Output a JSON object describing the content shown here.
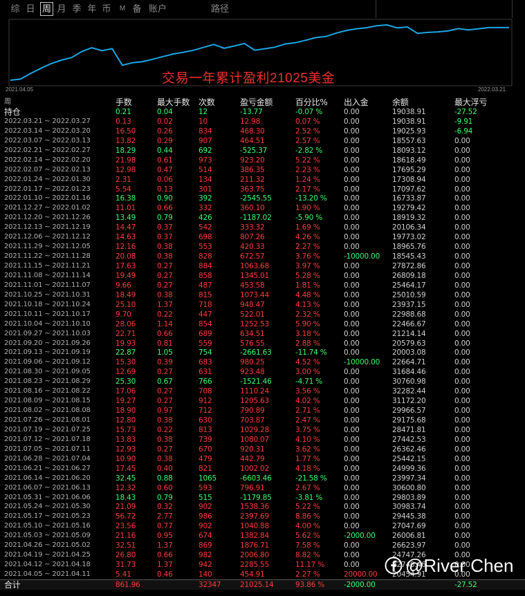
{
  "tabs": [
    {
      "label": "综"
    },
    {
      "label": "日"
    },
    {
      "label": "周",
      "active": true
    },
    {
      "label": "月"
    },
    {
      "label": "季"
    },
    {
      "label": "年"
    },
    {
      "label": "币"
    },
    {
      "label": "M"
    },
    {
      "label": "备"
    },
    {
      "label": "账户"
    },
    {
      "label": "路径"
    }
  ],
  "chart": {
    "start_label": "2021.04.05",
    "end_label": "2022.03.21",
    "caption": "交易一年累计盈利21025美金",
    "line_color": "#1aa7e6",
    "caption_color": "#e8322a"
  },
  "headers": [
    "周",
    "手数",
    "最大手数",
    "次数",
    "盈亏金额",
    "百分比%",
    "出入金",
    "余额",
    "最大浮亏"
  ],
  "hold_row": {
    "label": "持仓",
    "cols": [
      "0.21",
      "0.04",
      "12",
      "-13.77",
      "-0.07 %",
      "0.00",
      "19038.91",
      "-27.52"
    ],
    "sign": "neg"
  },
  "rows": [
    {
      "label": "2022.03.21 ~ 2022.03.27",
      "cols": [
        "0.13",
        "0.02",
        "10",
        "12.98",
        "0.07 %",
        "0.00",
        "19038.91",
        "-9.91"
      ],
      "sign": "pos",
      "dd": "neg"
    },
    {
      "label": "2022.03.14 ~ 2022.03.20",
      "cols": [
        "16.50",
        "0.26",
        "834",
        "468.30",
        "2.52 %",
        "0.00",
        "19025.93",
        "-6.94"
      ],
      "sign": "pos",
      "dd": "neg"
    },
    {
      "label": "2022.03.07 ~ 2022.03.13",
      "cols": [
        "13.82",
        "0.29",
        "907",
        "464.51",
        "2.57 %",
        "0.00",
        "18557.63",
        "0.00"
      ],
      "sign": "pos"
    },
    {
      "label": "2022.02.21 ~ 2022.02.27",
      "cols": [
        "18.29",
        "0.44",
        "692",
        "-525.37",
        "-2.82 %",
        "0.00",
        "18093.12",
        "0.00"
      ],
      "sign": "neg"
    },
    {
      "label": "2022.02.14 ~ 2022.02.20",
      "cols": [
        "21.98",
        "0.61",
        "973",
        "923.20",
        "5.22 %",
        "0.00",
        "18618.49",
        "0.00"
      ],
      "sign": "pos"
    },
    {
      "label": "2022.02.07 ~ 2022.02.13",
      "cols": [
        "12.98",
        "0.47",
        "514",
        "386.35",
        "2.23 %",
        "0.00",
        "17695.29",
        "0.00"
      ],
      "sign": "pos"
    },
    {
      "label": "2022.01.24 ~ 2022.01.30",
      "cols": [
        "2.31",
        "0.06",
        "134",
        "211.32",
        "1.24 %",
        "0.00",
        "17308.94",
        "0.00"
      ],
      "sign": "pos"
    },
    {
      "label": "2022.01.17 ~ 2022.01.23",
      "cols": [
        "5.54",
        "0.13",
        "301",
        "363.75",
        "2.17 %",
        "0.00",
        "17097.62",
        "0.00"
      ],
      "sign": "pos"
    },
    {
      "label": "2022.01.10 ~ 2022.01.16",
      "cols": [
        "16.38",
        "0.90",
        "392",
        "-2545.55",
        "-13.20 %",
        "0.00",
        "16733.87",
        "0.00"
      ],
      "sign": "neg"
    },
    {
      "label": "2021.12.27 ~ 2022.01.02",
      "cols": [
        "11.01",
        "0.66",
        "332",
        "360.10",
        "1.90 %",
        "0.00",
        "19279.42",
        "0.00"
      ],
      "sign": "pos"
    },
    {
      "label": "2021.12.20 ~ 2021.12.26",
      "cols": [
        "13.49",
        "0.79",
        "426",
        "-1187.02",
        "-5.90 %",
        "0.00",
        "18919.32",
        "0.00"
      ],
      "sign": "neg"
    },
    {
      "label": "2021.12.13 ~ 2021.12.19",
      "cols": [
        "14.47",
        "0.37",
        "542",
        "333.32",
        "1.69 %",
        "0.00",
        "20106.34",
        "0.00"
      ],
      "sign": "pos"
    },
    {
      "label": "2021.12.06 ~ 2021.12.12",
      "cols": [
        "14.63",
        "0.37",
        "698",
        "807.26",
        "4.26 %",
        "0.00",
        "19773.02",
        "0.00"
      ],
      "sign": "pos"
    },
    {
      "label": "2021.11.29 ~ 2021.12.05",
      "cols": [
        "12.16",
        "0.38",
        "553",
        "420.33",
        "2.27 %",
        "0.00",
        "18965.76",
        "0.00"
      ],
      "sign": "pos"
    },
    {
      "label": "2021.11.22 ~ 2021.11.28",
      "cols": [
        "20.08",
        "0.38",
        "828",
        "672.57",
        "3.76 %",
        "-10000.00",
        "18545.43",
        "0.00"
      ],
      "sign": "pos",
      "io": "neg"
    },
    {
      "label": "2021.11.15 ~ 2021.11.21",
      "cols": [
        "17.63",
        "0.27",
        "884",
        "1063.68",
        "3.97 %",
        "0.00",
        "27872.86",
        "0.00"
      ],
      "sign": "pos"
    },
    {
      "label": "2021.11.08 ~ 2021.11.14",
      "cols": [
        "19.49",
        "0.27",
        "858",
        "1345.01",
        "5.28 %",
        "0.00",
        "26809.18",
        "0.00"
      ],
      "sign": "pos"
    },
    {
      "label": "2021.11.01 ~ 2021.11.07",
      "cols": [
        "9.66",
        "0.27",
        "487",
        "453.58",
        "1.81 %",
        "0.00",
        "25464.17",
        "0.00"
      ],
      "sign": "pos"
    },
    {
      "label": "2021.10.25 ~ 2021.10.31",
      "cols": [
        "18.49",
        "0.38",
        "815",
        "1073.44",
        "4.48 %",
        "0.00",
        "25010.59",
        "0.00"
      ],
      "sign": "pos"
    },
    {
      "label": "2021.10.18 ~ 2021.10.24",
      "cols": [
        "25.10",
        "1.37",
        "718",
        "948.47",
        "4.13 %",
        "0.00",
        "23937.15",
        "0.00"
      ],
      "sign": "pos"
    },
    {
      "label": "2021.10.11 ~ 2021.10.17",
      "cols": [
        "9.70",
        "0.22",
        "447",
        "522.01",
        "2.32 %",
        "0.00",
        "22988.68",
        "0.00"
      ],
      "sign": "pos"
    },
    {
      "label": "2021.10.04 ~ 2021.10.10",
      "cols": [
        "28.06",
        "1.14",
        "854",
        "1252.53",
        "5.90 %",
        "0.00",
        "22466.67",
        "0.00"
      ],
      "sign": "pos"
    },
    {
      "label": "2021.09.27 ~ 2021.10.03",
      "cols": [
        "22.71",
        "0.66",
        "689",
        "634.51",
        "3.18 %",
        "0.00",
        "21214.14",
        "0.00"
      ],
      "sign": "pos"
    },
    {
      "label": "2021.09.20 ~ 2021.09.26",
      "cols": [
        "19.93",
        "0.81",
        "559",
        "576.55",
        "2.88 %",
        "0.00",
        "20579.63",
        "0.00"
      ],
      "sign": "pos"
    },
    {
      "label": "2021.09.13 ~ 2021.09.19",
      "cols": [
        "22.87",
        "1.05",
        "754",
        "-2661.63",
        "-11.74 %",
        "0.00",
        "20003.08",
        "0.00"
      ],
      "sign": "neg"
    },
    {
      "label": "2021.09.06 ~ 2021.09.12",
      "cols": [
        "15.30",
        "0.39",
        "683",
        "980.25",
        "4.52 %",
        "-10000.00",
        "22664.71",
        "0.00"
      ],
      "sign": "pos",
      "io": "neg"
    },
    {
      "label": "2021.08.30 ~ 2021.09.05",
      "cols": [
        "12.69",
        "0.27",
        "631",
        "923.48",
        "3.00 %",
        "0.00",
        "31684.46",
        "0.00"
      ],
      "sign": "pos"
    },
    {
      "label": "2021.08.23 ~ 2021.08.29",
      "cols": [
        "25.30",
        "0.67",
        "766",
        "-1521.46",
        "-4.71 %",
        "0.00",
        "30760.98",
        "0.00"
      ],
      "sign": "neg"
    },
    {
      "label": "2021.08.16 ~ 2021.08.22",
      "cols": [
        "17.06",
        "0.27",
        "708",
        "1110.24",
        "3.56 %",
        "0.00",
        "32282.44",
        "0.00"
      ],
      "sign": "pos"
    },
    {
      "label": "2021.08.09 ~ 2021.08.15",
      "cols": [
        "19.27",
        "0.27",
        "912",
        "1205.63",
        "4.02 %",
        "0.00",
        "31172.20",
        "0.00"
      ],
      "sign": "pos"
    },
    {
      "label": "2021.08.02 ~ 2021.08.08",
      "cols": [
        "18.90",
        "0.97",
        "712",
        "790.89",
        "2.71 %",
        "0.00",
        "29966.57",
        "0.00"
      ],
      "sign": "pos"
    },
    {
      "label": "2021.07.26 ~ 2021.08.01",
      "cols": [
        "12.80",
        "0.38",
        "630",
        "703.87",
        "2.47 %",
        "0.00",
        "29175.68",
        "0.00"
      ],
      "sign": "pos"
    },
    {
      "label": "2021.07.19 ~ 2021.07.25",
      "cols": [
        "15.73",
        "0.22",
        "813",
        "1029.28",
        "3.75 %",
        "0.00",
        "28471.81",
        "0.00"
      ],
      "sign": "pos"
    },
    {
      "label": "2021.07.12 ~ 2021.07.18",
      "cols": [
        "13.83",
        "0.38",
        "739",
        "1080.07",
        "4.10 %",
        "0.00",
        "27442.53",
        "0.00"
      ],
      "sign": "pos"
    },
    {
      "label": "2021.07.05 ~ 2021.07.11",
      "cols": [
        "12.93",
        "0.27",
        "670",
        "920.31",
        "3.62 %",
        "0.00",
        "26362.46",
        "0.00"
      ],
      "sign": "pos"
    },
    {
      "label": "2021.06.28 ~ 2021.07.04",
      "cols": [
        "10.90",
        "0.38",
        "479",
        "442.79",
        "1.77 %",
        "0.00",
        "25442.15",
        "0.00"
      ],
      "sign": "pos"
    },
    {
      "label": "2021.06.21 ~ 2021.06.27",
      "cols": [
        "17.45",
        "0.40",
        "821",
        "1002.02",
        "4.18 %",
        "0.00",
        "24999.36",
        "0.00"
      ],
      "sign": "pos"
    },
    {
      "label": "2021.06.14 ~ 2021.06.20",
      "cols": [
        "32.45",
        "0.88",
        "1065",
        "-6603.46",
        "-21.58 %",
        "0.00",
        "23997.34",
        "0.00"
      ],
      "sign": "neg"
    },
    {
      "label": "2021.06.07 ~ 2021.06.13",
      "cols": [
        "12.32",
        "0.60",
        "593",
        "796.91",
        "2.67 %",
        "0.00",
        "30600.80",
        "0.00"
      ],
      "sign": "pos"
    },
    {
      "label": "2021.05.31 ~ 2021.06.06",
      "cols": [
        "18.43",
        "0.79",
        "515",
        "-1179.85",
        "-3.81 %",
        "0.00",
        "29803.89",
        "0.00"
      ],
      "sign": "neg"
    },
    {
      "label": "2021.05.24 ~ 2021.05.30",
      "cols": [
        "21.09",
        "0.32",
        "902",
        "1538.36",
        "5.22 %",
        "0.00",
        "30983.74",
        "0.00"
      ],
      "sign": "pos"
    },
    {
      "label": "2021.05.17 ~ 2021.05.23",
      "cols": [
        "56.72",
        "2.77",
        "986",
        "2397.69",
        "8.86 %",
        "0.00",
        "29445.38",
        "0.00"
      ],
      "sign": "pos"
    },
    {
      "label": "2021.05.10 ~ 2021.05.16",
      "cols": [
        "23.56",
        "0.77",
        "902",
        "1040.88",
        "4.00 %",
        "0.00",
        "27047.69",
        "0.00"
      ],
      "sign": "pos"
    },
    {
      "label": "2021.05.03 ~ 2021.05.09",
      "cols": [
        "21.16",
        "0.95",
        "674",
        "1382.84",
        "5.62 %",
        "-2000.00",
        "26006.81",
        "0.00"
      ],
      "sign": "pos",
      "io": "neg"
    },
    {
      "label": "2021.04.26 ~ 2021.05.02",
      "cols": [
        "32.51",
        "1.37",
        "869",
        "1876.71",
        "7.58 %",
        "0.00",
        "26623.97",
        "0.00"
      ],
      "sign": "pos"
    },
    {
      "label": "2021.04.19 ~ 2021.04.25",
      "cols": [
        "26.80",
        "0.66",
        "982",
        "2006.80",
        "8.82 %",
        "0.00",
        "24747.26",
        "0.00"
      ],
      "sign": "pos"
    },
    {
      "label": "2021.04.12 ~ 2021.04.18",
      "cols": [
        "31.73",
        "1.37",
        "942",
        "2285.55",
        "11.17 %",
        "0.00",
        "22740.46",
        "0.00"
      ],
      "sign": "pos"
    },
    {
      "label": "2021.04.05 ~ 2021.04.11",
      "cols": [
        "5.41",
        "0.46",
        "140",
        "454.91",
        "2.27 %",
        "20000.00",
        "20454.91",
        "0.00"
      ],
      "sign": "pos",
      "io": "pos"
    }
  ],
  "total_row": {
    "label": "合计",
    "cols": [
      "861.96",
      "",
      "32347",
      "21025.14",
      "93.86 %",
      "-2000.00",
      "",
      "-27.52"
    ]
  },
  "watermark": {
    "icon": "facebook-icon",
    "text": "@River Chen"
  }
}
